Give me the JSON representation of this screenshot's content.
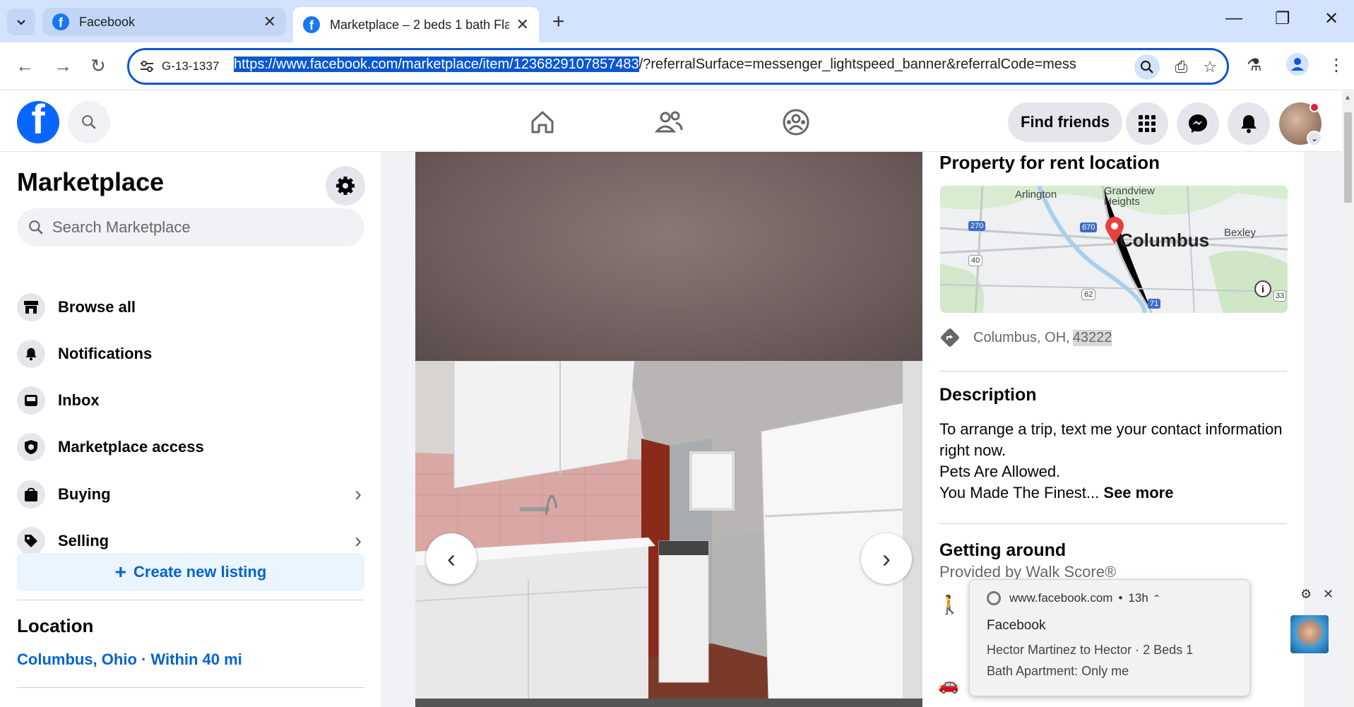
{
  "browser": {
    "tabs": [
      {
        "title": "Facebook",
        "active": false
      },
      {
        "title": "Marketplace – 2 beds 1 bath Fla",
        "active": true
      }
    ],
    "site_chip": "G-13-1337",
    "url_selected": "https://www.facebook.com/marketplace/item/1236829107857483",
    "url_rest": "/?referralSurface=messenger_lightspeed_banner&referralCode=mess"
  },
  "header": {
    "find_friends": "Find friends"
  },
  "sidebar": {
    "title": "Marketplace",
    "search_placeholder": "Search Marketplace",
    "items": [
      {
        "label": "Browse all"
      },
      {
        "label": "Notifications"
      },
      {
        "label": "Inbox"
      },
      {
        "label": "Marketplace access"
      },
      {
        "label": "Buying"
      },
      {
        "label": "Selling"
      }
    ],
    "create_listing": "Create new listing",
    "location_title": "Location",
    "location_value": "Columbus, Ohio · Within 40 mi"
  },
  "details": {
    "location_heading": "Property for rent location",
    "map_labels": {
      "arlington": "Arlington",
      "grandview": "Grandview Heights",
      "columbus": "Columbus",
      "bexley": "Bexley",
      "i270": "270",
      "i670": "670",
      "us40": "40",
      "us62": "62",
      "i71": "71",
      "us33": "33"
    },
    "location_text": "Columbus, OH, ",
    "location_zip": "43222",
    "description_heading": "Description",
    "description_lines": [
      "To arrange a trip, text me your contact information right now.",
      "Pets Are Allowed.",
      "You Made The Finest..."
    ],
    "see_more": "See more",
    "getting_around_heading": "Getting around",
    "getting_around_sub": "Provided by Walk Score®"
  },
  "notification": {
    "source": "www.facebook.com",
    "time": "13h",
    "title": "Facebook",
    "body": "Hector Martinez to Hector · 2 Beds 1 Bath Apartment: Only me"
  }
}
